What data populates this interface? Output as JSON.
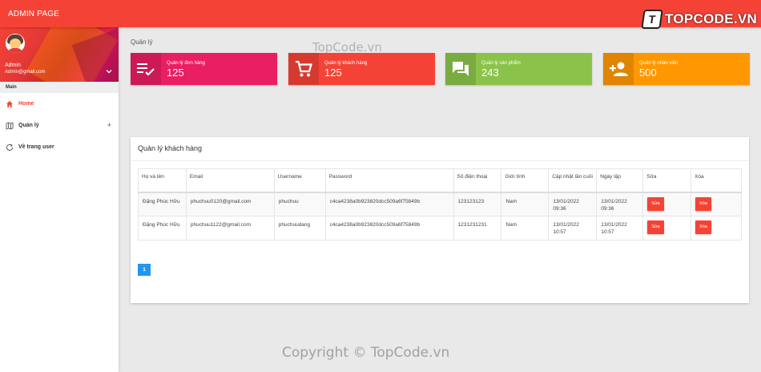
{
  "header": {
    "brand": "ADMIN PAGE",
    "logo_mark": "T",
    "logo_text": "TOPCODE.VN"
  },
  "sidebar": {
    "user": {
      "name": "Admin",
      "email": "Admin@gmail.com"
    },
    "menu_header": "Main",
    "items": [
      {
        "label": "Home",
        "icon": "home-icon",
        "active": true
      },
      {
        "label": "Quản lý",
        "icon": "map-icon",
        "expand": "+"
      },
      {
        "label": "Về trang user",
        "icon": "refresh-icon"
      }
    ]
  },
  "main": {
    "section_title": "Quản lý",
    "info_boxes": [
      {
        "text": "Quản lý đơn hàng",
        "number": "125",
        "color": "#e91e63",
        "icon": "playlist-check-icon"
      },
      {
        "text": "Quản lý khách hàng",
        "number": "125",
        "color": "#f44336",
        "icon": "shopping-cart-icon"
      },
      {
        "text": "Quản lý sản phẩm",
        "number": "243",
        "color": "#8bc34a",
        "icon": "forum-icon"
      },
      {
        "text": "Quản lý nhân viên",
        "number": "500",
        "color": "#ff9800",
        "icon": "person-add-icon"
      }
    ],
    "card": {
      "title": "Quản lý khách hàng",
      "columns": [
        "Họ và tên",
        "Email",
        "Username",
        "Password",
        "Số điện thoại",
        "Giới tính",
        "Cập nhật lần cuối",
        "Ngày lập",
        "Sửa",
        "Xóa"
      ],
      "rows": [
        {
          "name": "Đặng Phúc Hữu",
          "email": "phuchuu0120@gmail.com",
          "username": "phuchuu",
          "password": "c4ca4238a0b923820dcc509a6f75849b",
          "phone": "123123123",
          "gender": "Nam",
          "updated": "13/01/2022 09:36",
          "created": "13/01/2022 09:36",
          "edit": "Sửa",
          "delete": "Xóa"
        },
        {
          "name": "Đặng Phúc Hữu",
          "email": "phuchuu1122@gmail.com",
          "username": "phuchuudang",
          "password": "c4ca4238a0b923820dcc509a6f75849b",
          "phone": "1231231231",
          "gender": "Nam",
          "updated": "13/01/2022 10:57",
          "created": "13/01/2022 10:57",
          "edit": "Sửa",
          "delete": "Xóa"
        }
      ],
      "pagination": [
        "1"
      ]
    }
  },
  "watermarks": {
    "top": "TopCode.vn",
    "bottom": "Copyright © TopCode.vn"
  },
  "colors": {
    "primary": "#f44336",
    "pagination": "#2196f3"
  }
}
